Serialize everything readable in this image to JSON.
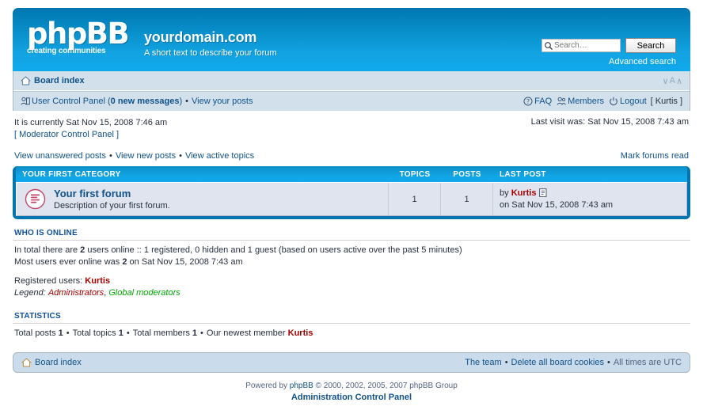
{
  "header": {
    "logo_text": "phpBB",
    "logo_sub": "creating communities",
    "site_title": "yourdomain.com",
    "site_tagline": "A short text to describe your forum",
    "search_placeholder": "Search…",
    "search_value": "",
    "search_button": "Search",
    "advanced_search": "Advanced search",
    "search_icon": "search-icon"
  },
  "nav": {
    "board_index": "Board index",
    "home_icon": "home-icon",
    "fontsize_decrease": "∨",
    "fontsize_letter": "A",
    "fontsize_increase": "∧",
    "ucp_icon": "user-control-panel-icon",
    "ucp_label_pre": "User Control Panel (",
    "ucp_count": "0 new messages",
    "ucp_label_post": ")",
    "bullet": "•",
    "view_your_posts": "View your posts",
    "faq": "FAQ",
    "faq_icon": "question-icon",
    "members": "Members",
    "members_icon": "members-icon",
    "logout": "Logout",
    "logout_icon": "power-icon",
    "logout_user": "[ Kurtis ]"
  },
  "info": {
    "current_time": "It is currently Sat Nov 15, 2008 7:46 am",
    "mcp_link": "[ Moderator Control Panel ]",
    "last_visit": "Last visit was: Sat Nov 15, 2008 7:43 am"
  },
  "actions": {
    "view_unanswered": "View unanswered posts",
    "view_new": "View new posts",
    "view_active": "View active topics",
    "bullet": "•",
    "mark_forums_read": "Mark forums read"
  },
  "forum_table": {
    "category": "YOUR FIRST CATEGORY",
    "col_topics": "TOPICS",
    "col_posts": "POSTS",
    "col_lastpost": "LAST POST",
    "rows": [
      {
        "icon": "forum-unread-icon",
        "name": "Your first forum",
        "description": "Description of your first forum.",
        "topics": "1",
        "posts": "1",
        "lastpost_by_prefix": "by",
        "lastpost_author": "Kurtis",
        "lastpost_goto_icon": "goto-last-post-icon",
        "lastpost_date": "on Sat Nov 15, 2008 7:43 am"
      }
    ]
  },
  "who_is_online": {
    "heading": "WHO IS ONLINE",
    "total_pre": "In total there are",
    "total_count": "2",
    "total_post": "users online :: 1 registered, 0 hidden and 1 guest (based on users active over the past 5 minutes)",
    "record_pre": "Most users ever online was",
    "record_count": "2",
    "record_post": "on Sat Nov 15, 2008 7:43 am",
    "registered_label": "Registered users:",
    "registered_users": "Kurtis",
    "legend_label": "Legend:",
    "legend_admins": "Administrators",
    "legend_separator": ",",
    "legend_mods": "Global moderators"
  },
  "statistics": {
    "heading": "STATISTICS",
    "total_posts_label": "Total posts",
    "total_posts": "1",
    "total_topics_label": "Total topics",
    "total_topics": "1",
    "total_members_label": "Total members",
    "total_members": "1",
    "newest_member_label": "Our newest member",
    "newest_member": "Kurtis",
    "bullet": "•"
  },
  "footer": {
    "board_index": "Board index",
    "home_icon": "home-icon",
    "the_team": "The team",
    "delete_cookies": "Delete all board cookies",
    "all_times": "All times are UTC",
    "bullet": "•"
  },
  "copyright": {
    "powered_pre": "Powered by",
    "phpbb": "phpBB",
    "powered_post": "© 2000, 2002, 2005, 2007 phpBB Group",
    "acp": "Administration Control Panel"
  },
  "colors": {
    "header_top": "#0076b1",
    "header_bottom": "#0fa9ec",
    "link": "#105289",
    "nav_bg": "#d2e0ec",
    "forum_border": "#0076b1",
    "row_bg": "#dfe4ef",
    "admin_red": "#AA0000",
    "mod_green": "#00AA00"
  }
}
